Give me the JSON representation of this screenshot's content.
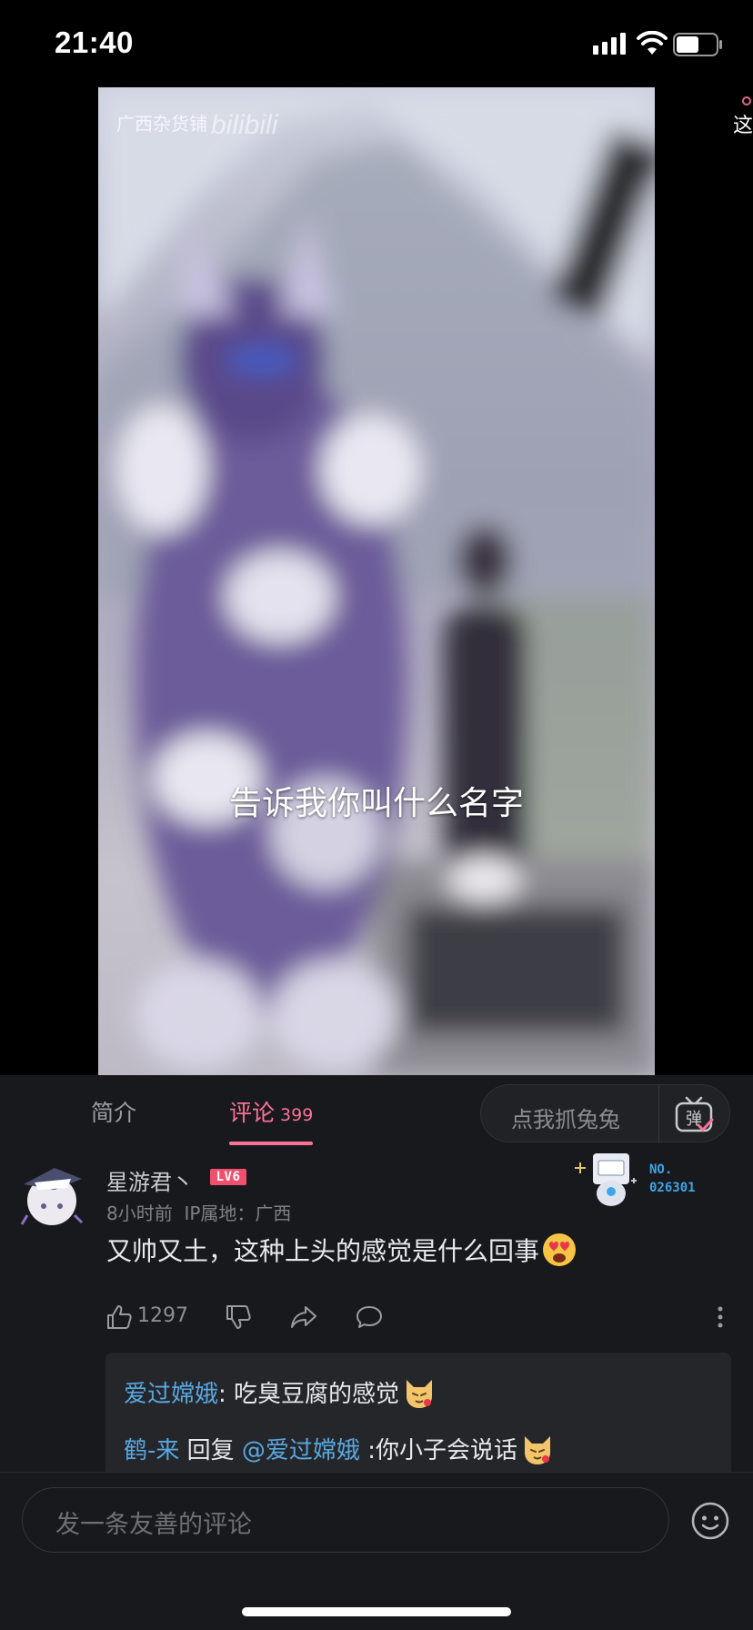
{
  "status_bar": {
    "time": "21:40"
  },
  "video": {
    "watermark_text": "广西杂货铺",
    "watermark_logo": "bilibili",
    "subtitle": "告诉我你叫什么名字",
    "side_peek_text": "这"
  },
  "tabs": {
    "intro": "简介",
    "comments": "评论",
    "comment_count": "399",
    "active": "comments"
  },
  "danmaku": {
    "placeholder": "点我抓兔兔",
    "toggle_label": "弹"
  },
  "comment": {
    "username": "星游君丶",
    "level": "LV6",
    "time": "8小时前",
    "ip_location": "IP属地：广西",
    "fan_card_no": "NO.",
    "fan_card_number": "026301",
    "text": "又帅又土，这种上头的感觉是什么回事",
    "emoji": "heart-eyes-emoji",
    "likes": "1297"
  },
  "replies": [
    {
      "user": "爱过嫦娥",
      "separator": ":",
      "text": " 吃臭豆腐的感觉",
      "emoji": "cat-emoji"
    },
    {
      "user": "鹤-来",
      "reply_word": " 回复 ",
      "mention": "@爱过嫦娥",
      "text": " :你小子会说话",
      "emoji": "cat-emoji"
    }
  ],
  "input": {
    "placeholder": "发一条友善的评论"
  },
  "colors": {
    "accent": "#fb7299",
    "link": "#58a8e0",
    "panel_bg": "#18191c",
    "level_badge": "#f0506e"
  }
}
